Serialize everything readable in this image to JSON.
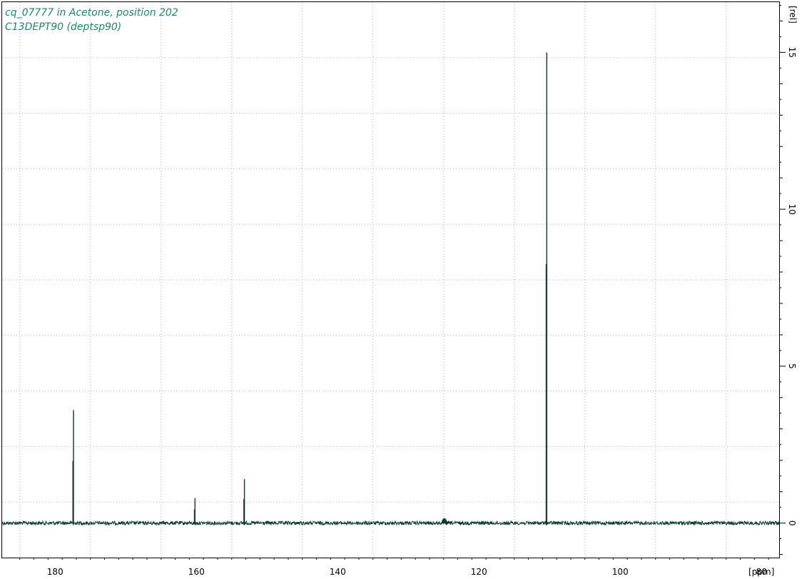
{
  "title": {
    "line1": "cq_07777 in Acetone, position 202",
    "line2": "C13DEPT90 (deptsp90)",
    "color": "#1a8a6a"
  },
  "colors": {
    "spectrum": "#0e3a35",
    "grid": "#b0b0b0",
    "frame": "#000000"
  },
  "chart_data": {
    "type": "line",
    "xlabel": "[ppm]",
    "ylabel": "[rel]",
    "x_reversed": true,
    "xlim": [
      187.5,
      77.5
    ],
    "ylim": [
      -1.1,
      16.6
    ],
    "x_ticks": [
      180,
      160,
      140,
      120,
      100,
      80
    ],
    "x_tick_labels": [
      "180",
      "160",
      "140",
      "120",
      "100",
      "80"
    ],
    "y_ticks": [
      0,
      5,
      10,
      15
    ],
    "y_tick_labels": [
      "0",
      "5",
      "10",
      "15"
    ],
    "grid": true,
    "peaks": [
      {
        "ppm": 177.4,
        "height": 3.6
      },
      {
        "ppm": 160.2,
        "height": 0.8
      },
      {
        "ppm": 153.2,
        "height": 1.4
      },
      {
        "ppm": 124.9,
        "height": 0.2
      },
      {
        "ppm": 110.4,
        "height": 15.0
      }
    ]
  }
}
